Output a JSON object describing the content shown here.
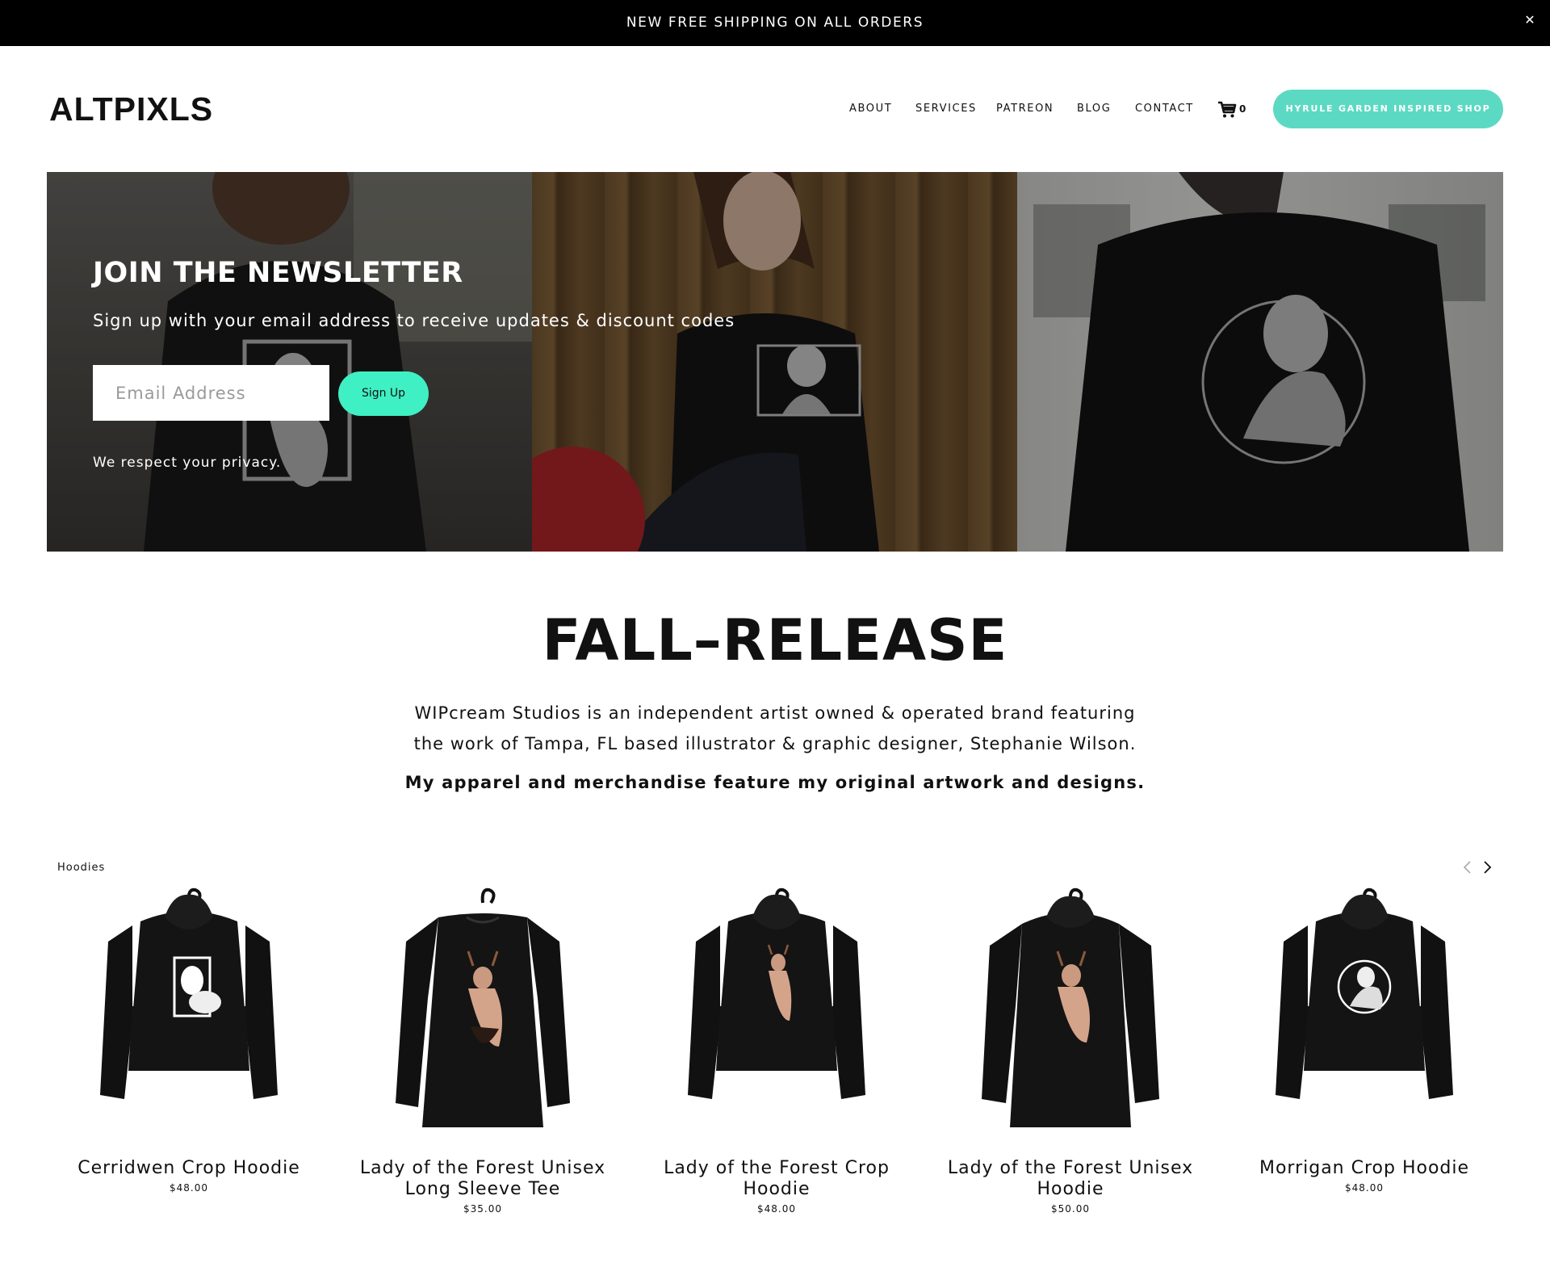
{
  "announcement": {
    "text": "NEW FREE SHIPPING ON ALL ORDERS",
    "close_icon": "close-icon"
  },
  "header": {
    "logo": "ALTPIXLS",
    "nav": [
      "ABOUT",
      "SERVICES",
      "PATREON",
      "BLOG",
      "CONTACT"
    ],
    "cart_count": "0",
    "cta": "HYRULE GARDEN INSPIRED SHOP"
  },
  "newsletter": {
    "title": "JOIN THE NEWSLETTER",
    "subtitle": "Sign up with your email address to receive updates & discount codes",
    "email_placeholder": "Email Address",
    "button": "Sign Up",
    "privacy": "We respect your privacy."
  },
  "release": {
    "title": "FALL–RELEASE",
    "description_line1": "WIPcream Studios is an independent artist owned & operated brand featuring",
    "description_line2": "the work of Tampa, FL based illustrator & graphic designer, Stephanie Wilson.",
    "tagline": "My apparel and merchandise feature my original artwork and designs."
  },
  "carousel": {
    "category": "Hoodies",
    "products": [
      {
        "name_line1": "Cerridwen Crop Hoodie",
        "name_line2": "",
        "price": "$48.00"
      },
      {
        "name_line1": "Lady of the Forest Unisex",
        "name_line2": "Long Sleeve Tee",
        "price": "$35.00"
      },
      {
        "name_line1": "Lady of the Forest Crop",
        "name_line2": "Hoodie",
        "price": "$48.00"
      },
      {
        "name_line1": "Lady of the Forest Unisex",
        "name_line2": "Hoodie",
        "price": "$50.00"
      },
      {
        "name_line1": "Morrigan Crop Hoodie",
        "name_line2": "",
        "price": "$48.00"
      }
    ]
  },
  "colors": {
    "accent": "#5cd9c2",
    "signup": "#3ff0c4",
    "bar": "#000000"
  }
}
